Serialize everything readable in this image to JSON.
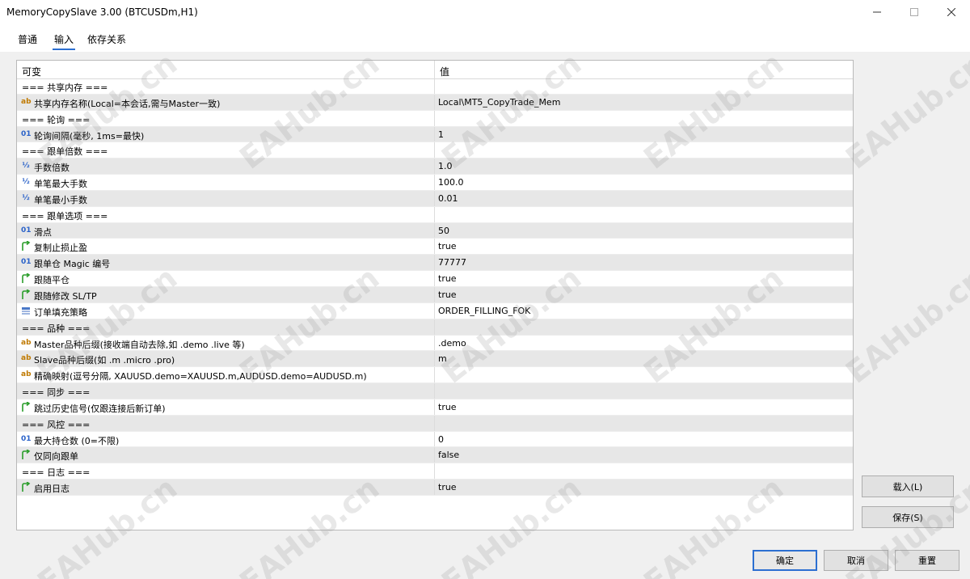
{
  "window": {
    "title": "MemoryCopySlave 3.00 (BTCUSDm,H1)"
  },
  "tabs": [
    {
      "label": "普通"
    },
    {
      "label": "输入"
    },
    {
      "label": "依存关系"
    }
  ],
  "active_tab": 1,
  "grid": {
    "headers": {
      "variable": "可变",
      "value": "值"
    },
    "rows": [
      {
        "type": "section",
        "label": "=== 共享内存 ===",
        "value": ""
      },
      {
        "type": "param",
        "icon": "ab",
        "label": "共享内存名称(Local=本会话,需与Master一致)",
        "value": "Local\\MT5_CopyTrade_Mem"
      },
      {
        "type": "section",
        "label": "=== 轮询 ===",
        "value": ""
      },
      {
        "type": "param",
        "icon": "01",
        "label": "轮询间隔(毫秒, 1ms=最快)",
        "value": "1"
      },
      {
        "type": "section",
        "label": "=== 跟单倍数 ===",
        "value": ""
      },
      {
        "type": "param",
        "icon": "half",
        "label": "手数倍数",
        "value": "1.0"
      },
      {
        "type": "param",
        "icon": "half",
        "label": "单笔最大手数",
        "value": "100.0"
      },
      {
        "type": "param",
        "icon": "half",
        "label": "单笔最小手数",
        "value": "0.01"
      },
      {
        "type": "section",
        "label": "=== 跟单选项 ===",
        "value": ""
      },
      {
        "type": "param",
        "icon": "01",
        "label": "滑点",
        "value": "50"
      },
      {
        "type": "param",
        "icon": "bool",
        "label": "复制止损止盈",
        "value": "true"
      },
      {
        "type": "param",
        "icon": "01",
        "label": "跟单仓 Magic 编号",
        "value": "77777"
      },
      {
        "type": "param",
        "icon": "bool",
        "label": "跟随平仓",
        "value": "true"
      },
      {
        "type": "param",
        "icon": "bool",
        "label": "跟随修改 SL/TP",
        "value": "true"
      },
      {
        "type": "param",
        "icon": "enum",
        "label": "订单填充策略",
        "value": "ORDER_FILLING_FOK"
      },
      {
        "type": "section",
        "label": "=== 品种 ===",
        "value": ""
      },
      {
        "type": "param",
        "icon": "ab",
        "label": "Master品种后缀(接收端自动去除,如 .demo .live 等)",
        "value": ".demo"
      },
      {
        "type": "param",
        "icon": "ab",
        "label": "Slave品种后缀(如 .m .micro .pro)",
        "value": "m"
      },
      {
        "type": "param",
        "icon": "ab",
        "label": "精确映射(逗号分隔, XAUUSD.demo=XAUUSD.m,AUDUSD.demo=AUDUSD.m)",
        "value": ""
      },
      {
        "type": "section",
        "label": "=== 同步 ===",
        "value": ""
      },
      {
        "type": "param",
        "icon": "bool",
        "label": "跳过历史信号(仅跟连接后新订单)",
        "value": "true"
      },
      {
        "type": "section",
        "label": "=== 风控 ===",
        "value": ""
      },
      {
        "type": "param",
        "icon": "01",
        "label": "最大持仓数 (0=不限)",
        "value": "0"
      },
      {
        "type": "param",
        "icon": "bool",
        "label": "仅同向跟单",
        "value": "false"
      },
      {
        "type": "section",
        "label": "=== 日志 ===",
        "value": ""
      },
      {
        "type": "param",
        "icon": "bool",
        "label": "启用日志",
        "value": "true"
      }
    ]
  },
  "buttons": {
    "load": "载入(L)",
    "save": "保存(S)",
    "ok": "确定",
    "cancel": "取消",
    "reset": "重置"
  },
  "watermark": {
    "text": "EAHub.cn"
  },
  "colors": {
    "accent": "#2c6fd1",
    "alt_row": "#e7e7e7"
  }
}
